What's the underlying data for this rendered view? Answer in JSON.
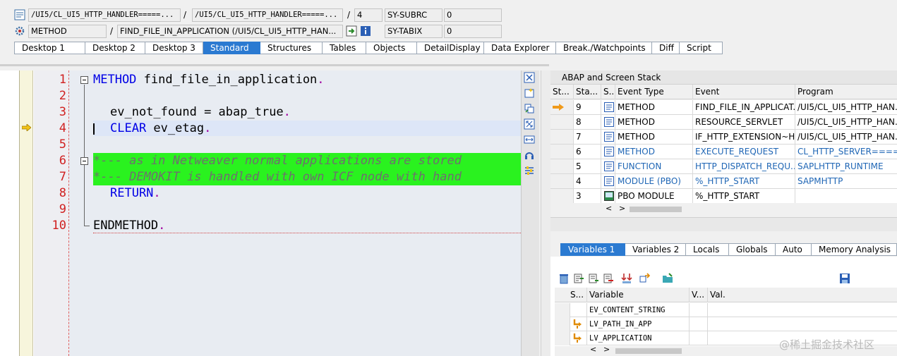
{
  "header": {
    "row1": {
      "field_a": "/UI5/CL_UI5_HTTP_HANDLER=====...",
      "slash1": "/",
      "field_b": "/UI5/CL_UI5_HTTP_HANDLER=====...",
      "slash2": "/",
      "field_c": "4",
      "sy_name": "SY-SUBRC",
      "sy_value": "0"
    },
    "row2": {
      "field_a": "METHOD",
      "slash1": "/",
      "field_b": "FIND_FILE_IN_APPLICATION (/UI5/CL_UI5_HTTP_HAN...",
      "sy_name": "SY-TABIX",
      "sy_value": "0"
    }
  },
  "tabs": [
    {
      "label": "Desktop 1"
    },
    {
      "label": "Desktop 2"
    },
    {
      "label": "Desktop 3"
    },
    {
      "label": "Standard"
    },
    {
      "label": "Structures"
    },
    {
      "label": "Tables"
    },
    {
      "label": "Objects"
    },
    {
      "label": "DetailDisplay"
    },
    {
      "label": "Data Explorer"
    },
    {
      "label": "Break./Watchpoints"
    },
    {
      "label": "Diff"
    },
    {
      "label": "Script"
    }
  ],
  "editor": {
    "line_numbers": [
      "1",
      "2",
      "3",
      "4",
      "5",
      "6",
      "7",
      "8",
      "9",
      "10"
    ],
    "lines": {
      "l1_kw": "METHOD",
      "l1_rest": " find_file_in_application",
      "l1_dot": ".",
      "l3_a": "ev_not_found",
      "l3_eq": " = ",
      "l3_b": "abap_true",
      "l3_dot": ".",
      "l4_kw": "CLEAR",
      "l4_rest": " ev_etag",
      "l4_dot": ".",
      "l6": "*--- as in Netweaver normal applications are stored",
      "l7": "*--- DEMOKIT is handled with own ICF node with hand",
      "l8_kw": "RETURN",
      "l8_dot": ".",
      "l10_kw": "ENDMETHOD",
      "l10_dot": "."
    }
  },
  "stack": {
    "title": "ABAP and Screen Stack",
    "columns": [
      "St...",
      "Sta...",
      "S...",
      "Event Type",
      "Event",
      "Program"
    ],
    "rows": [
      {
        "level": "9",
        "type": "METHOD",
        "event": "FIND_FILE_IN_APPLICAT...",
        "program": "/UI5/CL_UI5_HTTP_HAN...",
        "current": true,
        "blue": false
      },
      {
        "level": "8",
        "type": "METHOD",
        "event": "RESOURCE_SERVLET",
        "program": "/UI5/CL_UI5_HTTP_HAN...",
        "current": false,
        "blue": false
      },
      {
        "level": "7",
        "type": "METHOD",
        "event": "IF_HTTP_EXTENSION~H...",
        "program": "/UI5/CL_UI5_HTTP_HAN...",
        "current": false,
        "blue": false
      },
      {
        "level": "6",
        "type": "METHOD",
        "event": "EXECUTE_REQUEST",
        "program": "CL_HTTP_SERVER====...",
        "current": false,
        "blue": true
      },
      {
        "level": "5",
        "type": "FUNCTION",
        "event": "HTTP_DISPATCH_REQU...",
        "program": "SAPLHTTP_RUNTIME",
        "current": false,
        "blue": true
      },
      {
        "level": "4",
        "type": "MODULE (PBO)",
        "event": "%_HTTP_START",
        "program": "SAPMHTTP",
        "current": false,
        "blue": true
      },
      {
        "level": "3",
        "type": "PBO MODULE",
        "event": "%_HTTP_START",
        "program": "",
        "current": false,
        "blue": false
      }
    ]
  },
  "var_tabs": [
    {
      "label": "Variables 1"
    },
    {
      "label": "Variables 2"
    },
    {
      "label": "Locals"
    },
    {
      "label": "Globals"
    },
    {
      "label": "Auto"
    },
    {
      "label": "Memory Analysis"
    }
  ],
  "variables": {
    "columns": [
      "S...",
      "Variable",
      "V...",
      "Val."
    ],
    "rows": [
      {
        "name": "EV_CONTENT_STRING",
        "icon": false
      },
      {
        "name": "LV_PATH_IN_APP",
        "icon": true
      },
      {
        "name": "LV_APPLICATION",
        "icon": true
      }
    ]
  },
  "watermark": "@稀土掘金技术社区",
  "colors": {
    "accent": "#2b7ad1",
    "comment_bg": "#2af21f",
    "keyword": "#0000e6",
    "line_number": "#d02020"
  }
}
